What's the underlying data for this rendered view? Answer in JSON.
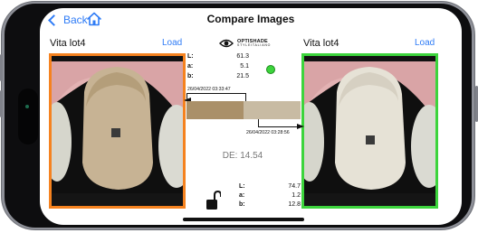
{
  "header": {
    "back_label": "Back",
    "title": "Compare Images"
  },
  "left": {
    "title": "Vita lot4",
    "load_label": "Load",
    "timestamp": "26/04/2022 03:33:47",
    "border_color": "#f5821f"
  },
  "right": {
    "title": "Vita lot4",
    "load_label": "Load",
    "timestamp": "26/04/2022 03:28:56",
    "border_color": "#3cd43c"
  },
  "brand": {
    "name": "OPTISHADE",
    "tagline": "STYLEITALIANO"
  },
  "lab_top": {
    "L_key": "L:",
    "L": "61.3",
    "a_key": "a:",
    "a": "5.1",
    "b_key": "b:",
    "b": "21.5"
  },
  "lab_bottom": {
    "L_key": "L:",
    "L": "74.7",
    "a_key": "a:",
    "a": "1.2",
    "b_key": "b:",
    "b": "12.8"
  },
  "delta_e": "DE: 14.54",
  "swatch_colors": {
    "left": "#aa9069",
    "right": "#c8bba3"
  },
  "status_color": "#3cd43c",
  "icons": [
    "back-chevron-icon",
    "home-icon",
    "eye-logo-icon",
    "unlock-icon"
  ]
}
